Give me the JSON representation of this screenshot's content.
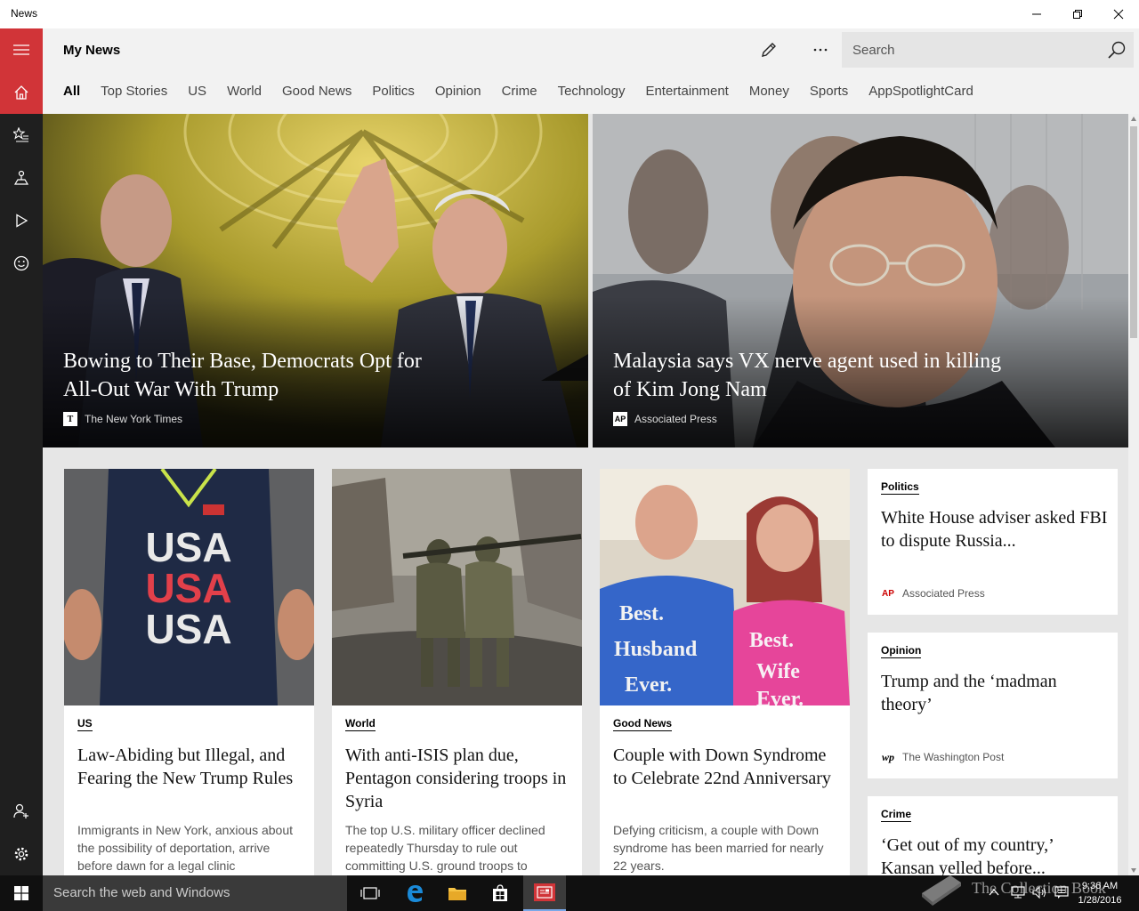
{
  "window": {
    "title": "News"
  },
  "header": {
    "title": "My News",
    "search_placeholder": "Search",
    "tabs": [
      "All",
      "Top Stories",
      "US",
      "World",
      "Good News",
      "Politics",
      "Opinion",
      "Crime",
      "Technology",
      "Entertainment",
      "Money",
      "Sports",
      "AppSpotlightCard"
    ]
  },
  "heroes": [
    {
      "title": "Bowing to Their Base, Democrats Opt for All-Out War With Trump",
      "source": "The New York Times",
      "source_logo": "T"
    },
    {
      "title": "Malaysia says VX nerve agent used in killing of Kim Jong Nam",
      "source": "Associated Press",
      "source_logo": "AP"
    }
  ],
  "cards": [
    {
      "category": "US",
      "title": "Law-Abiding but Illegal, and Fearing the New Trump Rules",
      "desc": "Immigrants in New York, anxious about the possibility of deportation, arrive before dawn for a legal clinic",
      "shirt_text": [
        "USA",
        "USA",
        "USA"
      ]
    },
    {
      "category": "World",
      "title": "With anti-ISIS plan due, Pentagon considering troops in Syria",
      "desc": "The top U.S. military officer declined repeatedly Thursday to rule out committing U.S. ground troops to"
    },
    {
      "category": "Good News",
      "title": "Couple with Down Syndrome to Celebrate 22nd Anniversary",
      "desc": "Defying criticism, a couple with Down syndrome has been married for nearly 22 years.",
      "shirt_left": [
        "Best.",
        "Husband",
        "Ever."
      ],
      "shirt_right": [
        "Best.",
        "Wife",
        "Ever."
      ]
    }
  ],
  "side_cards": [
    {
      "category": "Politics",
      "title": "White House adviser asked FBI to dispute Russia...",
      "source": "Associated Press",
      "source_logo": "AP"
    },
    {
      "category": "Opinion",
      "title": "Trump and the ‘madman theory’",
      "source": "The Washington Post",
      "source_logo": "wp"
    },
    {
      "category": "Crime",
      "title": "‘Get out of my country,’ Kansan yelled before..."
    }
  ],
  "taskbar": {
    "search_placeholder": "Search the web and Windows",
    "time": "9:36 AM",
    "date": "1/28/2016"
  },
  "watermark": "The Collection Book",
  "colors": {
    "accent": "#d13438",
    "sidebar": "#1f1f1f",
    "header": "#f2f2f2"
  }
}
